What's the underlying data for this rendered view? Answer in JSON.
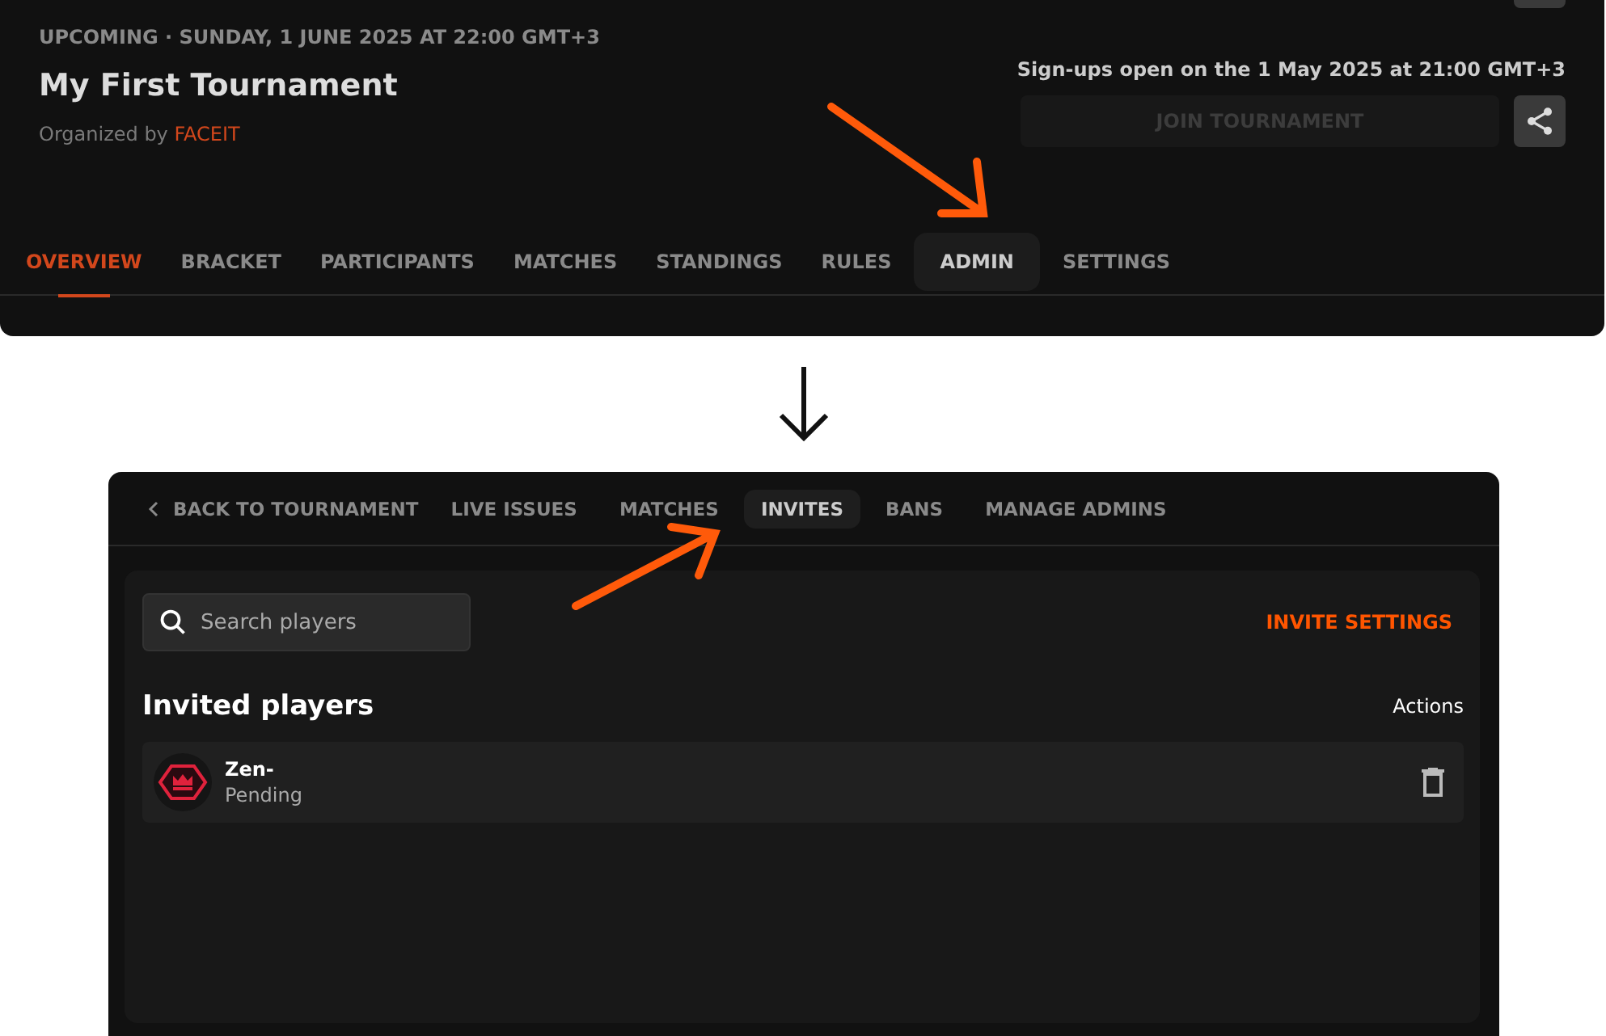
{
  "tournament": {
    "meta": "UPCOMING · SUNDAY, 1 JUNE 2025 AT 22:00 GMT+3",
    "title": "My First Tournament",
    "organizer_prefix": "Organized by",
    "organizer": "FACEIT",
    "signup_note": "Sign-ups open on the 1 May 2025 at 21:00 GMT+3",
    "join_button": {
      "label": "JOIN TOURNAMENT",
      "disabled": true
    }
  },
  "tabs": [
    {
      "label": "OVERVIEW",
      "selected": true,
      "hovered": false
    },
    {
      "label": "BRACKET",
      "selected": false,
      "hovered": false
    },
    {
      "label": "PARTICIPANTS",
      "selected": false,
      "hovered": false
    },
    {
      "label": "MATCHES",
      "selected": false,
      "hovered": false
    },
    {
      "label": "STANDINGS",
      "selected": false,
      "hovered": false
    },
    {
      "label": "RULES",
      "selected": false,
      "hovered": false
    },
    {
      "label": "ADMIN",
      "selected": false,
      "hovered": true
    },
    {
      "label": "SETTINGS",
      "selected": false,
      "hovered": false
    }
  ],
  "admin": {
    "back": "BACK TO TOURNAMENT",
    "tabs": [
      {
        "label": "LIVE ISSUES",
        "selected": false
      },
      {
        "label": "MATCHES",
        "selected": false
      },
      {
        "label": "INVITES",
        "selected": true
      },
      {
        "label": "BANS",
        "selected": false
      },
      {
        "label": "MANAGE ADMINS",
        "selected": false
      }
    ],
    "search": {
      "placeholder": "Search players"
    },
    "invite_settings": "INVITE SETTINGS",
    "section_title": "Invited players",
    "actions_header": "Actions",
    "players": [
      {
        "name": "Zen-",
        "status": "Pending"
      }
    ]
  }
}
